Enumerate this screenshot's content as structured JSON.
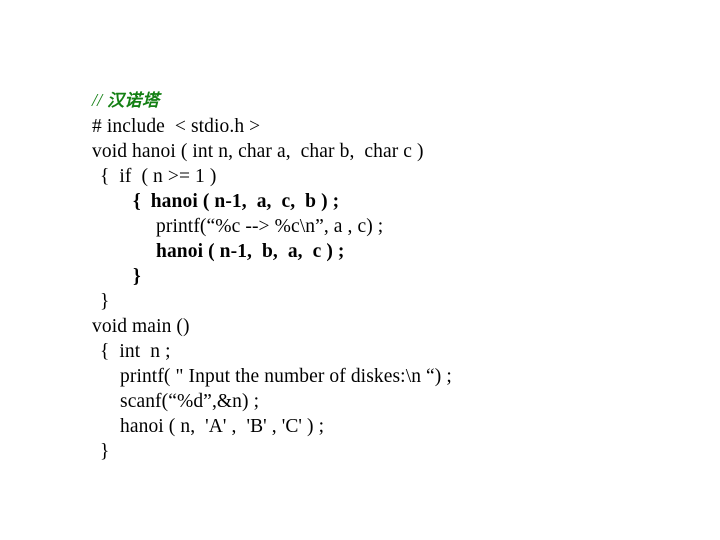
{
  "slide": {
    "background_color": "#ffffff",
    "text_color": "#000000",
    "comment_color": "#148014"
  },
  "code": {
    "language": "C",
    "title_comment": {
      "slashes": "//",
      "text": "汉诺塔"
    },
    "lines": [
      {
        "text": "// 汉诺塔",
        "indent": 0,
        "bold": true,
        "italic": true,
        "color": "#148014",
        "comment": true
      },
      {
        "text": "# include  < stdio.h >",
        "indent": 0,
        "bold": false
      },
      {
        "text": "void hanoi ( int n, char a,  char b,  char c )",
        "indent": 0,
        "bold": false
      },
      {
        "text": "{  if  ( n >= 1 )",
        "indent": 1,
        "bold": false
      },
      {
        "text": "{  hanoi ( n-1,  a,  c,  b ) ;",
        "indent": 3,
        "bold": true
      },
      {
        "text": "printf(“%c --> %c\\n”, a , c) ;",
        "indent": 4,
        "bold": false
      },
      {
        "text": "hanoi ( n-1,  b,  a,  c ) ;",
        "indent": 4,
        "bold": true
      },
      {
        "text": "}",
        "indent": 3,
        "bold": true
      },
      {
        "text": "}",
        "indent": 1,
        "bold": false
      },
      {
        "text": "void main ()",
        "indent": 0,
        "bold": false
      },
      {
        "text": "{  int  n ;",
        "indent": 1,
        "bold": false
      },
      {
        "text": "printf( \" Input the number of diskes:\\n “) ;",
        "indent": 2,
        "bold": false
      },
      {
        "text": "scanf(“%d”,&n) ;",
        "indent": 2,
        "bold": false
      },
      {
        "text": "hanoi ( n,  'A' ,  'B' , 'C' ) ;",
        "indent": 2,
        "bold": false
      },
      {
        "text": "}",
        "indent": 1,
        "bold": false
      }
    ]
  }
}
